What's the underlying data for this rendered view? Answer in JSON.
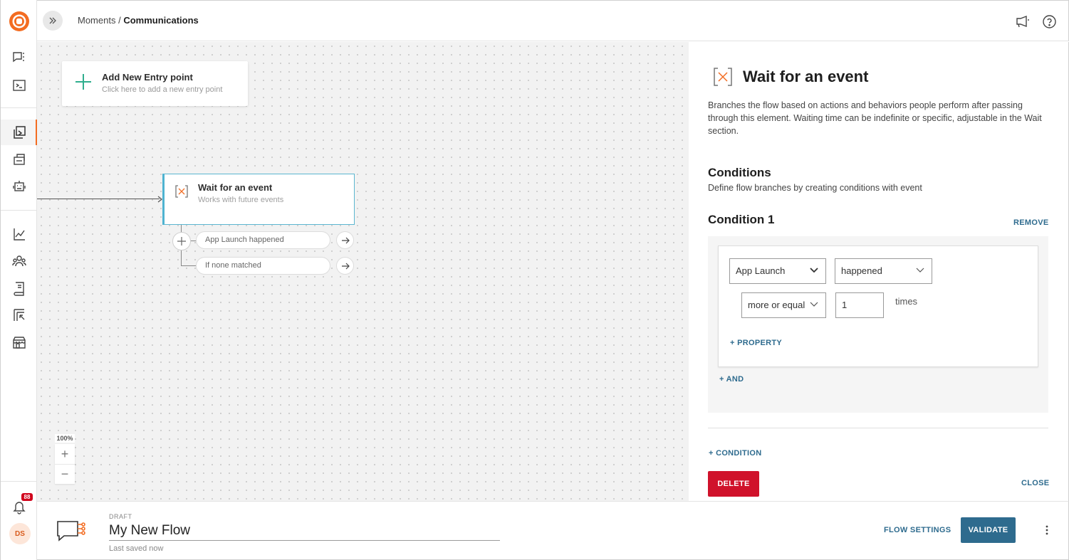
{
  "header": {
    "breadcrumb_parent": "Moments",
    "breadcrumb_separator": " / ",
    "breadcrumb_current": "Communications"
  },
  "sidebar": {
    "notification_count": "88",
    "avatar_initials": "DS"
  },
  "canvas": {
    "entry_card": {
      "title": "Add New Entry point",
      "subtitle": "Click here to add a new entry point"
    },
    "wait_card": {
      "title": "Wait for an event",
      "subtitle": "Works with future events"
    },
    "branches": [
      {
        "label": "App Launch happened"
      },
      {
        "label": "If none matched"
      }
    ],
    "zoom_level": "100%",
    "zoom_in": "+",
    "zoom_out": "−"
  },
  "panel": {
    "title": "Wait for an event",
    "description": "Branches the flow based on actions and behaviors people perform after passing through this element. Waiting time can be indefinite or specific, adjustable in the Wait section.",
    "conditions_heading": "Conditions",
    "conditions_subheading": "Define flow branches by creating conditions with event",
    "condition_title": "Condition 1",
    "remove_label": "REMOVE",
    "event_select": "App Launch",
    "occurrence_select": "happened",
    "comparator_select": "more or equal",
    "count_value": "1",
    "times_label": "times",
    "add_property_label": "+ PROPERTY",
    "add_and_label": "+ AND",
    "add_condition_label": "+ CONDITION",
    "delete_label": "DELETE",
    "close_label": "CLOSE"
  },
  "bottom": {
    "status": "DRAFT",
    "flow_name": "My New Flow",
    "last_saved": "Last saved now",
    "flow_settings_label": "FLOW SETTINGS",
    "validate_label": "VALIDATE"
  },
  "colors": {
    "brand_orange": "#f36c21",
    "accent_blue": "#2e6b8e",
    "node_border": "#4fb3d1",
    "danger_red": "#d0122b"
  }
}
